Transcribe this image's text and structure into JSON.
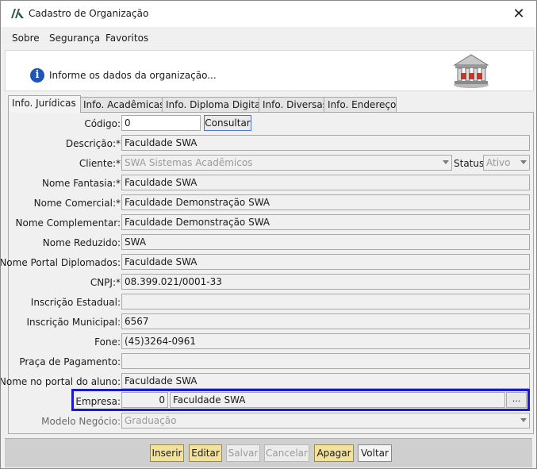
{
  "window": {
    "title": "Cadastro de Organização",
    "close_glyph": "✕"
  },
  "menu": {
    "items": [
      "Sobre",
      "Segurança",
      "Favoritos"
    ]
  },
  "header": {
    "message": "Informe os dados da organização..."
  },
  "tabs": [
    "Info. Jurídicas",
    "Info. Acadêmicas",
    "Info. Diploma Digital",
    "Info. Diversas",
    "Info. Endereço"
  ],
  "active_tab": "Info. Jurídicas",
  "form": {
    "codigo": {
      "label": "Código:",
      "value": "0",
      "button": "Consultar"
    },
    "descricao": {
      "label": "Descrição:*",
      "value": "Faculdade SWA"
    },
    "cliente": {
      "label": "Cliente:*",
      "value": "SWA Sistemas Acadêmicos"
    },
    "status": {
      "label": "Status:",
      "value": "Ativo"
    },
    "nome_fantasia": {
      "label": "Nome Fantasia:*",
      "value": "Faculdade SWA"
    },
    "nome_comercial": {
      "label": "Nome Comercial:*",
      "value": "Faculdade Demonstração SWA"
    },
    "nome_complementar": {
      "label": "Nome Complementar:",
      "value": "Faculdade Demonstração SWA"
    },
    "nome_reduzido": {
      "label": "Nome Reduzido:",
      "value": "SWA"
    },
    "nome_portal_diplomados": {
      "label": "Nome Portal Diplomados:",
      "value": "Faculdade SWA"
    },
    "cnpj": {
      "label": "CNPJ:*",
      "value": "08.399.021/0001-33"
    },
    "inscricao_estadual": {
      "label": "Inscrição Estadual:",
      "value": ""
    },
    "inscricao_municipal": {
      "label": "Inscrição Municipal:",
      "value": "6567"
    },
    "fone": {
      "label": "Fone:",
      "value": "(45)3264-0961"
    },
    "praca_pagamento": {
      "label": "Praça de Pagamento:",
      "value": ""
    },
    "nome_portal_aluno": {
      "label": "Nome no portal do aluno:",
      "value": "Faculdade SWA"
    },
    "empresa": {
      "label": "Empresa:",
      "code": "0",
      "name": "Faculdade SWA",
      "button": "..."
    },
    "modelo_negocio": {
      "label": "Modelo Negócio:",
      "value": "Graduação"
    }
  },
  "footer": {
    "inserir": "Inserir",
    "editar": "Editar",
    "salvar": "Salvar",
    "cancelar": "Cancelar",
    "apagar": "Apagar",
    "voltar": "Voltar"
  },
  "colors": {
    "highlight": "#1a1ad0",
    "action_button": "#f2e29a",
    "info_icon": "#1d56b4"
  }
}
